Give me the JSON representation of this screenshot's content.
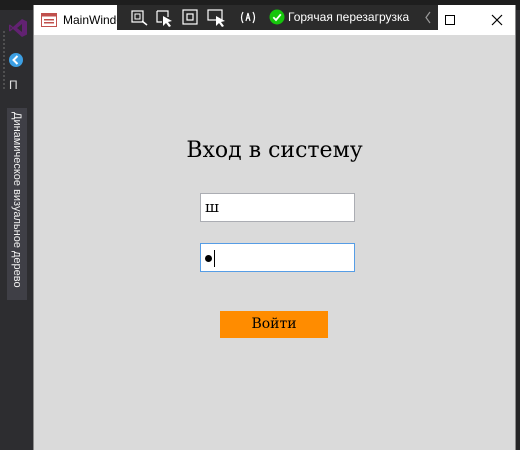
{
  "ide": {
    "left_tab_letter": "П",
    "vertical_tab_label": "Динамическое визуальное дерево"
  },
  "window": {
    "title": "MainWindow",
    "icons": {
      "app": "wpf-window-icon",
      "minimize": "minimize-icon",
      "maximize": "maximize-icon",
      "close": "close-icon"
    }
  },
  "debug_toolbar": {
    "buttons": [
      "go-to-live-visual-tree-icon",
      "select-element-icon",
      "display-layout-adorners-icon",
      "track-focused-element-icon",
      "binding-failures-icon"
    ],
    "hot_reload_label": "Горячая перезагрузка",
    "hot_reload_status_color": "#16c60c"
  },
  "login": {
    "title": "Вход в систему",
    "username_value": "ш",
    "password_masked": "●",
    "button_label": "Войти",
    "button_color": "#ff8c00"
  }
}
